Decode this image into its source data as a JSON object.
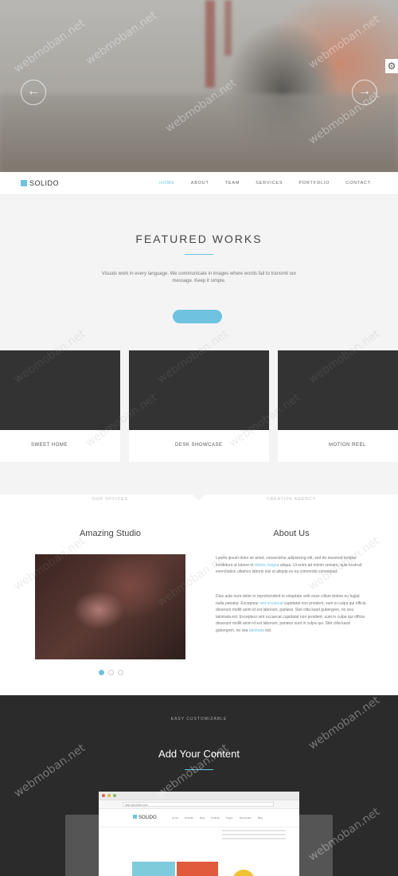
{
  "hero": {
    "prev_icon": "arrow-left-icon",
    "next_icon": "arrow-right-icon",
    "settings_icon": "gear-icon"
  },
  "brand": {
    "name": "SOLIDO",
    "accent": "#6fc3e0"
  },
  "nav": {
    "items": [
      "HOME",
      "ABOUT",
      "TEAM",
      "SERVICES",
      "PORTFOLIO",
      "CONTACT"
    ],
    "active": "HOME"
  },
  "featured": {
    "title": "FEATURED WORKS",
    "description": "Visuals work in every language. We communicate in images where words fail to transmit our message. Keep it simple.",
    "cards": [
      {
        "label": "SWEET HOME"
      },
      {
        "label": "DESK SHOWCASE"
      },
      {
        "label": "MOTION REEL"
      }
    ]
  },
  "studio": {
    "left_sub": "OUR OFFICES",
    "left_title": "Amazing Studio",
    "right_sub": "CREATIVE AGENCY",
    "right_title": "About Us",
    "para1_a": "Lorem ipsum dolor sit amet, consectetur adipisicing elit, sed do eiusmod tempor incididunt ut labore et ",
    "para1_link": "dolore magna",
    "para1_b": " aliqua. Ut enim ad minim veniam, quis nostrud exercitation ullamco laboris nisi ut aliquip ex ea commodo consequat.",
    "para2_a": "Duis aute irure dolor in reprehenderit in voluptate velit esse cillum dolore eu fugiat nulla pariatur. Excepteur ",
    "para2_link1": "sint occaecat",
    "para2_b": " cupidatat non proident, sunt in culpa qui officia deserunt mollit anim id est laborum, pariatur. Stet clita kasd gubergren, no sea takimata est. Excepteur sint occaecat cupidatat non proident, sunt in culpa qui officia deserunt mollit anim id est laborum, pariatur sunt in culpa qui. Stet clita kasd gubergren, no sea ",
    "para2_link2": "takimata",
    "para2_c": " est.",
    "dots": 3
  },
  "custom": {
    "sub": "EASY CUSTOMIZABLE",
    "title": "Add Your Content",
    "browser_url": "http://yoursite.com",
    "browser_logo": "SOLIDO",
    "browser_links": [
      "Home",
      "Portfolio",
      "Blog",
      "Portfolio",
      "Pages",
      "Shortcodes",
      "Blog"
    ]
  },
  "watermark": "webmoban.net"
}
